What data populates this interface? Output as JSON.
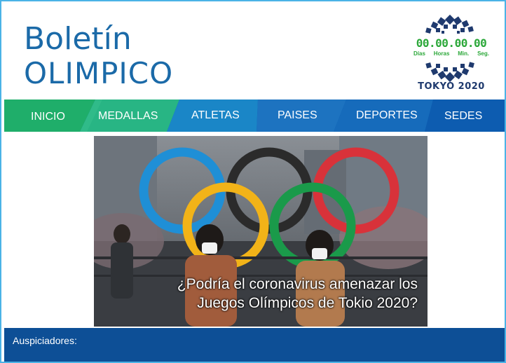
{
  "header": {
    "title_line1": "Boletín",
    "title_line2": "OLIMPICO"
  },
  "countdown": {
    "value": "00.00.00.00",
    "units": [
      "Días",
      "Horas",
      "Min.",
      "Seg."
    ],
    "event_label": "TOKYO 2020"
  },
  "nav": {
    "items": [
      "INICIO",
      "MEDALLAS",
      "ATLETAS",
      "PAISES",
      "DEPORTES",
      "SEDES"
    ]
  },
  "hero": {
    "headline_line1": "¿Podría el coronavirus amenazar los",
    "headline_line2": "Juegos Olímpicos de Tokio 2020?"
  },
  "footer": {
    "sponsors_label": "Auspiciadores:"
  },
  "colors": {
    "brand_blue": "#1b6aa8",
    "nav_green": "#2bb673",
    "nav_blue": "#0b5fb0",
    "footer_blue": "#0d4f96",
    "countdown_green": "#2ca83a"
  }
}
